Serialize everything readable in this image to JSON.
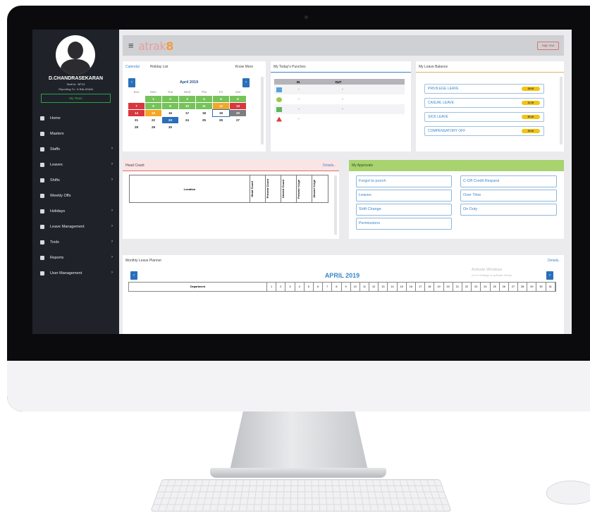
{
  "app": {
    "logo": "atrak",
    "version": "8",
    "signout_label": "Sign Out"
  },
  "user": {
    "name": "D.CHANDRASEKARAN",
    "staff_id": "Staff Id : BP13",
    "reporting_to": "Reporting To : K.BALASAM",
    "team_button": "My Team"
  },
  "nav": [
    {
      "label": "Home",
      "icon": "home-icon",
      "arrow": false
    },
    {
      "label": "Masters",
      "icon": "file-icon",
      "arrow": false
    },
    {
      "label": "Staffs",
      "icon": "user-icon",
      "arrow": true
    },
    {
      "label": "Leaves",
      "icon": "calendar-icon",
      "arrow": true
    },
    {
      "label": "Shifts",
      "icon": "clock-icon",
      "arrow": true
    },
    {
      "label": "Weekly Offs",
      "icon": "list-icon",
      "arrow": false
    },
    {
      "label": "Holidays",
      "icon": "calendar-icon",
      "arrow": true
    },
    {
      "label": "Leave Management",
      "icon": "folder-icon",
      "arrow": true
    },
    {
      "label": "Tools",
      "icon": "wrench-icon",
      "arrow": true
    },
    {
      "label": "Reports",
      "icon": "chart-icon",
      "arrow": true
    },
    {
      "label": "User Management",
      "icon": "users-icon",
      "arrow": true
    }
  ],
  "calendar": {
    "tabs": [
      "Calendar",
      "Holiday List"
    ],
    "know_more": "Know More",
    "month": "April  2019",
    "day_names": [
      "Sun",
      "Mon",
      "Tue",
      "Wed",
      "Thu",
      "Fri",
      "Sat"
    ],
    "days": [
      {
        "t": "",
        "c": "blank"
      },
      {
        "t": "1",
        "c": "green"
      },
      {
        "t": "2",
        "c": "green"
      },
      {
        "t": "3",
        "c": "green"
      },
      {
        "t": "4",
        "c": "green"
      },
      {
        "t": "5",
        "c": "green"
      },
      {
        "t": "6",
        "c": "green"
      },
      {
        "t": "7",
        "c": "red"
      },
      {
        "t": "8",
        "c": "green"
      },
      {
        "t": "9",
        "c": "green"
      },
      {
        "t": "10",
        "c": "green"
      },
      {
        "t": "11",
        "c": "green"
      },
      {
        "t": "12",
        "c": "orange"
      },
      {
        "t": "13",
        "c": "red"
      },
      {
        "t": "14",
        "c": "red"
      },
      {
        "t": "15",
        "c": "orange"
      },
      {
        "t": "16",
        "c": "plain"
      },
      {
        "t": "17",
        "c": "plain"
      },
      {
        "t": "18",
        "c": "plain"
      },
      {
        "t": "19",
        "c": "outline"
      },
      {
        "t": "20",
        "c": "grey"
      },
      {
        "t": "21",
        "c": "plain"
      },
      {
        "t": "22",
        "c": "plain"
      },
      {
        "t": "23",
        "c": "blue"
      },
      {
        "t": "24",
        "c": "plain"
      },
      {
        "t": "25",
        "c": "plain"
      },
      {
        "t": "26",
        "c": "plain"
      },
      {
        "t": "27",
        "c": "plain"
      },
      {
        "t": "28",
        "c": "plain"
      },
      {
        "t": "29",
        "c": "plain"
      },
      {
        "t": "30",
        "c": "plain"
      }
    ]
  },
  "punches": {
    "title": "My Today's Punches",
    "col_in": "IN",
    "col_out": "OUT",
    "rows": [
      {
        "icon": "calendar-icon",
        "color": "#5aa0dc",
        "in": "-",
        "out": "-"
      },
      {
        "icon": "clock-icon",
        "color": "#9ac94b",
        "in": "-",
        "out": "-"
      },
      {
        "icon": "id-card-icon",
        "color": "#5fb55f",
        "in": "-",
        "out": "-"
      },
      {
        "icon": "warning-icon",
        "color": "#e23b3b",
        "in": "-",
        "out": ""
      }
    ]
  },
  "leave_balance": {
    "title": "My Leave Balance",
    "items": [
      {
        "label": "PRIVILEGE LEAVE",
        "value": "28.00"
      },
      {
        "label": "CASUAL LEAVE",
        "value": "31.00"
      },
      {
        "label": "SICK LEAVE",
        "value": "60.00"
      },
      {
        "label": "COMPENSATORY OFF",
        "value": "30.00"
      }
    ]
  },
  "head_count": {
    "title": "Head Count",
    "details": "Details..",
    "columns": [
      "Location",
      "Head Count",
      "Present Count",
      "Absent Count",
      "Present %Age",
      "Absent %Age"
    ]
  },
  "approvals": {
    "title": "My Approvals",
    "items": [
      "Forgot to punch",
      "C-Off Credit Request",
      "Leaves",
      "Over Time",
      "Shift Change",
      "On Duty",
      "Permissions"
    ]
  },
  "planner": {
    "title": "Monthly Leave Planner",
    "details": "Details..",
    "month": "APRIL  2019",
    "department_label": "Department",
    "days": [
      "1",
      "2",
      "3",
      "4",
      "5",
      "6",
      "7",
      "8",
      "9",
      "10",
      "11",
      "12",
      "13",
      "14",
      "15",
      "16",
      "17",
      "18",
      "19",
      "20",
      "21",
      "22",
      "23",
      "24",
      "25",
      "26",
      "27",
      "28",
      "29",
      "30",
      "31"
    ]
  },
  "watermark": {
    "line1": "Activate Windows",
    "line2": "Go to Settings to activate Windo"
  },
  "colors": {
    "green": "#76c35b",
    "red": "#d9363e",
    "orange": "#f5a623",
    "blue": "#2a6fba",
    "grey": "#7d7d83",
    "accent": "#3a86c8"
  }
}
